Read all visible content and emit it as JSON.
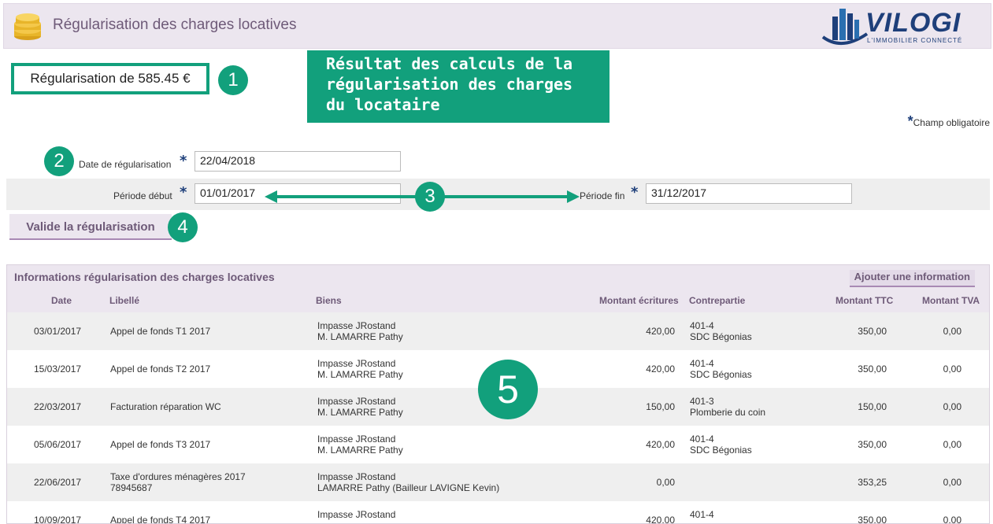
{
  "header": {
    "title": "Régularisation des charges locatives",
    "logo_name": "VILOGI",
    "logo_tagline": "L'IMMOBILIER CONNECTÉ"
  },
  "summary": {
    "text": "Régularisation de 585.45 €"
  },
  "callout": {
    "text": "Résultat des calculs de la\nrégularisation des charges\ndu locataire"
  },
  "badges": [
    "1",
    "2",
    "3",
    "4",
    "5"
  ],
  "required_note": "Champ obligatoire",
  "form": {
    "date_label": "Date de régularisation",
    "date_value": "22/04/2018",
    "start_label": "Période début",
    "start_value": "01/01/2017",
    "end_label": "Période fin",
    "end_value": "31/12/2017",
    "validate_label": "Valide la régularisation"
  },
  "panel": {
    "title": "Informations régularisation des charges locatives",
    "add_label": "Ajouter une information",
    "columns": [
      "Date",
      "Libellé",
      "Biens",
      "Montant écritures",
      "Contrepartie",
      "Montant TTC",
      "Montant TVA"
    ],
    "rows": [
      {
        "date": "03/01/2017",
        "libelle1": "Appel de fonds T1 2017",
        "libelle2": "",
        "bien1": "Impasse JRostand",
        "bien2": "M. LAMARRE Pathy",
        "montant": "420,00",
        "contre1": "401-4",
        "contre2": "SDC Bégonias",
        "ttc": "350,00",
        "tva": "0,00"
      },
      {
        "date": "15/03/2017",
        "libelle1": "Appel de fonds T2 2017",
        "libelle2": "",
        "bien1": "Impasse JRostand",
        "bien2": "M. LAMARRE Pathy",
        "montant": "420,00",
        "contre1": "401-4",
        "contre2": "SDC Bégonias",
        "ttc": "350,00",
        "tva": "0,00"
      },
      {
        "date": "22/03/2017",
        "libelle1": "Facturation réparation WC",
        "libelle2": "",
        "bien1": "Impasse JRostand",
        "bien2": "M. LAMARRE Pathy",
        "montant": "150,00",
        "contre1": "401-3",
        "contre2": "Plomberie du coin",
        "ttc": "150,00",
        "tva": "0,00"
      },
      {
        "date": "05/06/2017",
        "libelle1": "Appel de fonds T3 2017",
        "libelle2": "",
        "bien1": "Impasse JRostand",
        "bien2": "M. LAMARRE Pathy",
        "montant": "420,00",
        "contre1": "401-4",
        "contre2": "SDC Bégonias",
        "ttc": "350,00",
        "tva": "0,00"
      },
      {
        "date": "22/06/2017",
        "libelle1": "Taxe d'ordures ménagères 2017",
        "libelle2": "78945687",
        "bien1": "Impasse JRostand",
        "bien2": "LAMARRE Pathy (Bailleur LAVIGNE Kevin)",
        "montant": "0,00",
        "contre1": "",
        "contre2": "",
        "ttc": "353,25",
        "tva": "0,00"
      },
      {
        "date": "10/09/2017",
        "libelle1": "Appel de fonds T4 2017",
        "libelle2": "",
        "bien1": "Impasse JRostand",
        "bien2": "",
        "montant": "420,00",
        "contre1": "401-4",
        "contre2": "",
        "ttc": "350,00",
        "tva": "0,00"
      }
    ]
  },
  "colors": {
    "accent_green": "#12a07c",
    "header_bg": "#ece6ef",
    "title_purple": "#6e5a78",
    "logo_blue": "#1e3f7a"
  }
}
